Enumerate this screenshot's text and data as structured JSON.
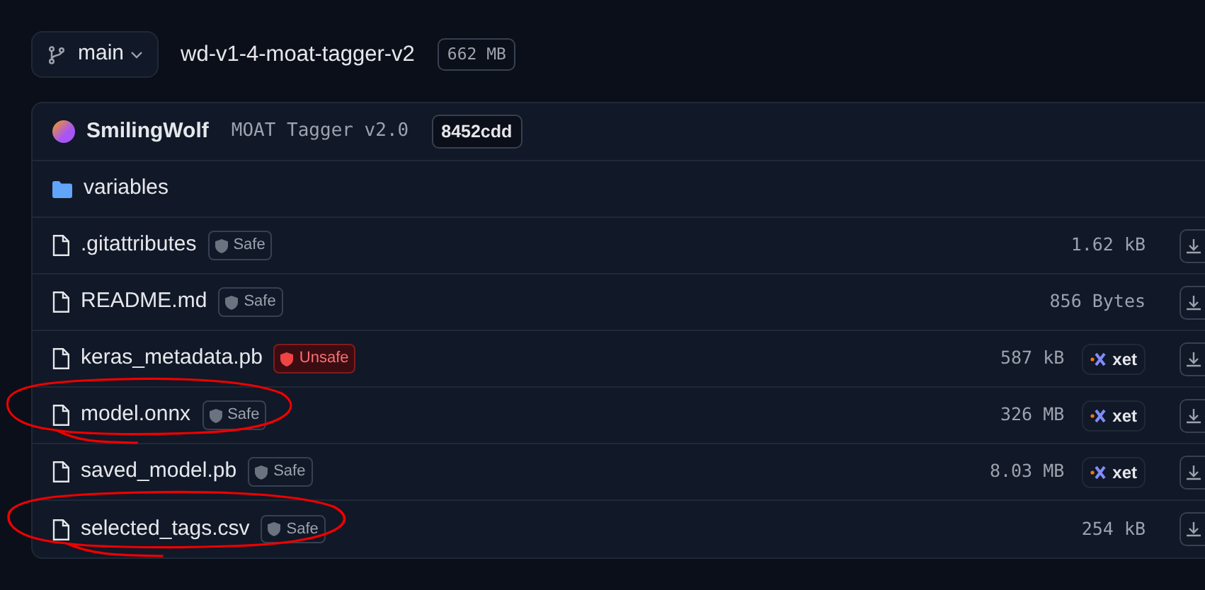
{
  "branch": {
    "label": "main"
  },
  "repo": {
    "name": "wd-v1-4-moat-tagger-v2",
    "size": "662 MB"
  },
  "commit": {
    "author": "SmilingWolf",
    "message": "MOAT Tagger v2.0",
    "hash": "8452cdd"
  },
  "files": [
    {
      "kind": "folder",
      "name": "variables",
      "highlighted": false
    },
    {
      "kind": "file",
      "name": ".gitattributes",
      "security": "Safe",
      "unsafe": false,
      "size": "1.62 kB",
      "highlighted": false
    },
    {
      "kind": "file",
      "name": "README.md",
      "security": "Safe",
      "unsafe": false,
      "size": "856 Bytes",
      "highlighted": false
    },
    {
      "kind": "file",
      "name": "keras_metadata.pb",
      "security": "Unsafe",
      "unsafe": true,
      "size": "587 kB",
      "storage": "xet",
      "highlighted": false
    },
    {
      "kind": "file",
      "name": "model.onnx",
      "security": "Safe",
      "unsafe": false,
      "size": "326 MB",
      "storage": "xet",
      "highlighted": true
    },
    {
      "kind": "file",
      "name": "saved_model.pb",
      "security": "Safe",
      "unsafe": false,
      "size": "8.03 MB",
      "storage": "xet",
      "highlighted": false
    },
    {
      "kind": "file",
      "name": "selected_tags.csv",
      "security": "Safe",
      "unsafe": false,
      "size": "254 kB",
      "highlighted": true
    }
  ]
}
